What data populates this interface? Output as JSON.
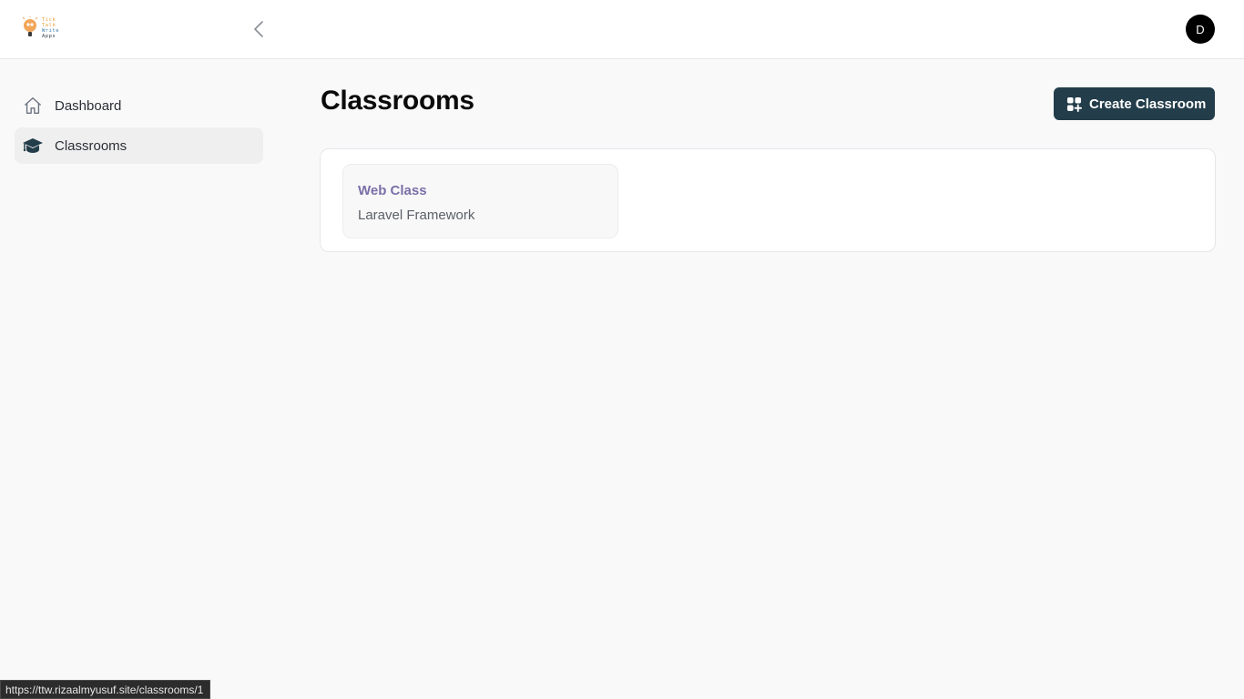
{
  "header": {
    "logo_lines": [
      "Tick",
      "Talk",
      "Write",
      "Apps"
    ],
    "avatar_initial": "D"
  },
  "sidebar": {
    "items": [
      {
        "label": "Dashboard",
        "icon": "home-icon",
        "active": false
      },
      {
        "label": "Classrooms",
        "icon": "graduation-cap-icon",
        "active": true
      }
    ]
  },
  "main": {
    "title": "Classrooms",
    "create_button_label": "Create Classroom",
    "classrooms": [
      {
        "name": "Web Class",
        "subject": "Laravel Framework"
      }
    ]
  },
  "status_bar": {
    "url": "https://ttw.rizaalmyusuf.site/classrooms/1"
  },
  "colors": {
    "primary": "#233d4a",
    "class_name": "#7b6fa8",
    "background": "#f9f9f9"
  }
}
